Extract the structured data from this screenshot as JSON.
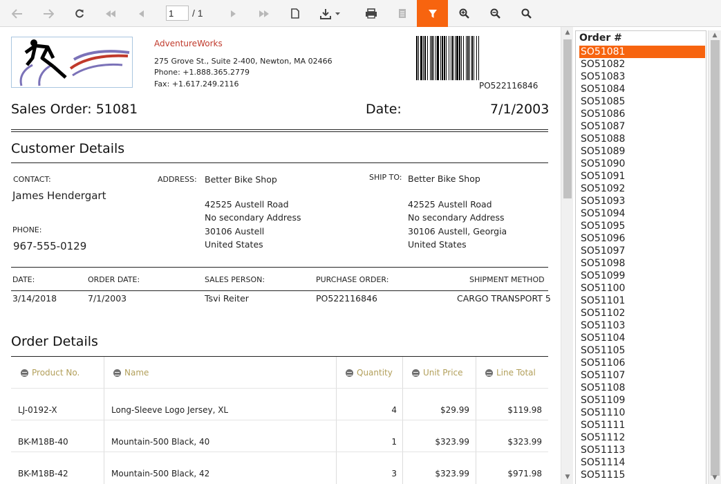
{
  "toolbar": {
    "page_value": "1",
    "page_of": "/ 1",
    "icons": [
      "first-icon",
      "back-icon",
      "refresh-icon",
      "first-page-icon",
      "prev-page-icon",
      "next-page-icon",
      "last-page-icon",
      "document-icon",
      "export-icon",
      "print-icon",
      "print-page-icon",
      "filter-icon",
      "zoom-in-icon",
      "zoom-out-icon",
      "search-icon"
    ],
    "accent": "#f7640f"
  },
  "report": {
    "company": "AdventureWorks",
    "address_line": "275 Grove St., Suite 2-400, Newton, MA 02466",
    "phone_line": "Phone: +1.888.365.2779",
    "fax_line": "Fax: +1.617.249.2116",
    "barcode_text": "PO522116846",
    "sales_order_label": "Sales Order: 51081",
    "date_label": "Date:",
    "date_value": "7/1/2003",
    "customer_details_title": "Customer Details",
    "contact_label": "CONTACT:",
    "contact_name": "James Hendergart",
    "phone_label": "PHONE:",
    "phone_value": "967-555-0129",
    "address_label": "ADDRESS:",
    "address": {
      "name": "Better Bike Shop",
      "line1": "42525 Austell Road",
      "line2": "No secondary Address",
      "line3": "30106 Austell",
      "line4": "United States"
    },
    "ship_to_label": "SHIP TO:",
    "ship_to": {
      "name": "Better Bike Shop",
      "line1": "42525 Austell Road",
      "line2": "No secondary Address",
      "line3": "30106 Austell, Georgia",
      "line4": "United States"
    },
    "info_headers": [
      "DATE:",
      "ORDER DATE:",
      "SALES PERSON:",
      "PURCHASE ORDER:",
      "SHIPMENT METHOD"
    ],
    "info_values": [
      "3/14/2018",
      "7/1/2003",
      "Tsvi Reiter",
      "PO522116846",
      "CARGO TRANSPORT 5"
    ],
    "order_details_title": "Order Details",
    "columns": [
      "Product No.",
      "Name",
      "Quantity",
      "Unit Price",
      "Line Total"
    ],
    "rows": [
      [
        "LJ-0192-X",
        "Long-Sleeve Logo Jersey, XL",
        "4",
        "$29.99",
        "$119.98"
      ],
      [
        "BK-M18B-40",
        "Mountain-500 Black, 40",
        "1",
        "$323.99",
        "$323.99"
      ],
      [
        "BK-M18B-42",
        "Mountain-500 Black, 42",
        "3",
        "$323.99",
        "$971.98"
      ]
    ]
  },
  "sidebar": {
    "header": "Order #",
    "selected": "SO51081",
    "items": [
      "SO51081",
      "SO51082",
      "SO51083",
      "SO51084",
      "SO51085",
      "SO51086",
      "SO51087",
      "SO51088",
      "SO51089",
      "SO51090",
      "SO51091",
      "SO51092",
      "SO51093",
      "SO51094",
      "SO51095",
      "SO51096",
      "SO51097",
      "SO51098",
      "SO51099",
      "SO51100",
      "SO51101",
      "SO51102",
      "SO51103",
      "SO51104",
      "SO51105",
      "SO51106",
      "SO51107",
      "SO51108",
      "SO51109",
      "SO51110",
      "SO51111",
      "SO51112",
      "SO51113",
      "SO51114",
      "SO51115"
    ]
  }
}
